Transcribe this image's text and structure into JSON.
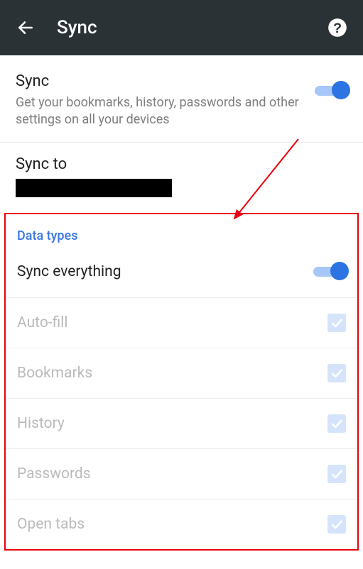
{
  "header": {
    "title": "Sync"
  },
  "sync": {
    "title": "Sync",
    "subtitle": "Get your bookmarks, history, passwords and other settings on all your devices",
    "enabled": true
  },
  "syncTo": {
    "label": "Sync to"
  },
  "dataTypes": {
    "header": "Data types",
    "syncEverything": {
      "label": "Sync everything",
      "enabled": true
    },
    "items": [
      {
        "label": "Auto-fill",
        "checked": true
      },
      {
        "label": "Bookmarks",
        "checked": true
      },
      {
        "label": "History",
        "checked": true
      },
      {
        "label": "Passwords",
        "checked": true
      },
      {
        "label": "Open tabs",
        "checked": true
      }
    ]
  },
  "annotation": {
    "color": "#e7000a"
  }
}
